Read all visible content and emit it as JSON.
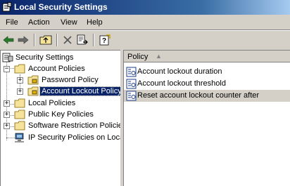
{
  "window": {
    "title": "Local Security Settings"
  },
  "menu": [
    "File",
    "Action",
    "View",
    "Help"
  ],
  "toolbar": {
    "icons": [
      "back-arrow-icon",
      "forward-arrow-icon",
      "up-folder-icon",
      "delete-icon",
      "export-list-icon",
      "help-icon"
    ]
  },
  "tree": {
    "root": "Security Settings",
    "items": [
      {
        "label": "Account Policies",
        "expanded": true
      },
      {
        "label": "Password Policy"
      },
      {
        "label": "Account Lockout Policy",
        "selected": true
      },
      {
        "label": "Local Policies"
      },
      {
        "label": "Public Key Policies"
      },
      {
        "label": "Software Restriction Policie"
      },
      {
        "label": "IP Security Policies on Loca"
      }
    ]
  },
  "list": {
    "column": "Policy",
    "rows": [
      "Account lockout duration",
      "Account lockout threshold",
      "Reset account lockout counter after"
    ]
  }
}
